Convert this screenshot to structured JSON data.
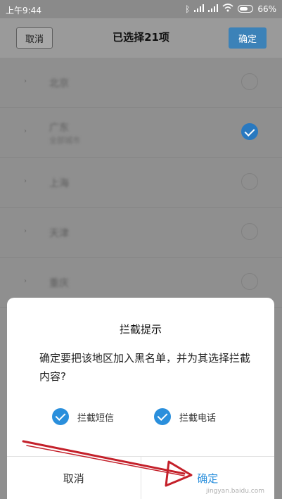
{
  "status_bar": {
    "time": "上午9:44",
    "battery": "66%"
  },
  "header": {
    "cancel_label": "取消",
    "title": "已选择21项",
    "confirm_label": "确定"
  },
  "list": {
    "items": [
      {
        "name": "北京",
        "sub": "",
        "checked": false
      },
      {
        "name": "广东",
        "sub": "全部城市",
        "checked": true
      },
      {
        "name": "上海",
        "sub": "",
        "checked": false
      },
      {
        "name": "天津",
        "sub": "",
        "checked": false
      },
      {
        "name": "重庆",
        "sub": "",
        "checked": false
      }
    ]
  },
  "dialog": {
    "title": "拦截提示",
    "message": "确定要把该地区加入黑名单，并为其选择拦截内容?",
    "options": [
      {
        "label": "拦截短信",
        "checked": true
      },
      {
        "label": "拦截电话",
        "checked": true
      }
    ],
    "cancel_label": "取消",
    "confirm_label": "确定"
  },
  "watermark": "jingyan.baidu.com",
  "colors": {
    "accent": "#2a8fdc",
    "arrow": "#c4202a"
  }
}
